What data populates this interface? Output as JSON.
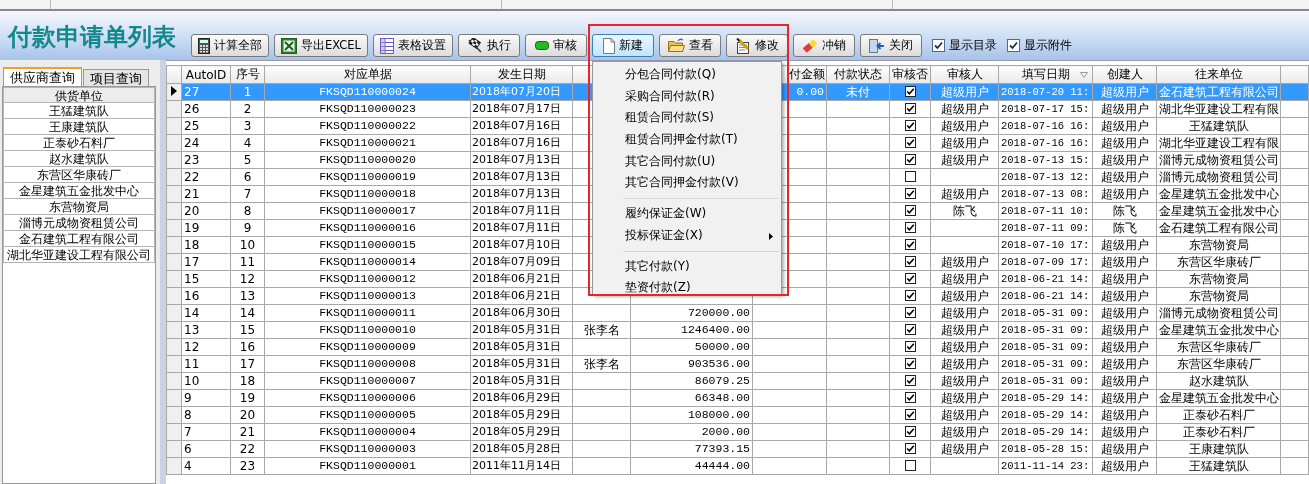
{
  "window": {
    "title": "付款申请单列表"
  },
  "toolbar": {
    "buttons": [
      {
        "label": "计算全部",
        "pressed": false
      },
      {
        "label": "导出EXCEL",
        "pressed": false
      },
      {
        "label": "表格设置",
        "pressed": false
      },
      {
        "label": "执行",
        "pressed": false
      },
      {
        "label": "审核",
        "pressed": false
      },
      {
        "label": "新建",
        "pressed": true
      },
      {
        "label": "查看",
        "pressed": false
      },
      {
        "label": "修改",
        "pressed": false
      },
      {
        "label": "冲销",
        "pressed": false
      },
      {
        "label": "关闭",
        "pressed": false
      }
    ],
    "checkboxes": [
      {
        "label": "显示目录",
        "checked": true
      },
      {
        "label": "显示附件",
        "checked": true
      }
    ]
  },
  "left_panel": {
    "tabs": [
      {
        "label": "供应商查询",
        "selected": true
      },
      {
        "label": "项目查询",
        "selected": false
      }
    ],
    "list_header": "供货单位",
    "items": [
      "王猛建筑队",
      "王康建筑队",
      "正泰砂石料厂",
      "赵水建筑队",
      "东营区华康砖厂",
      "金星建筑五金批发中心",
      "东营物资局",
      "淄博元成物资租赁公司",
      "金石建筑工程有限公司",
      "湖北华亚建设工程有限公司"
    ]
  },
  "table": {
    "columns": [
      {
        "label": "AutoID",
        "sorted": false
      },
      {
        "label": "序号",
        "sorted": false
      },
      {
        "label": "对应单据",
        "sorted": false
      },
      {
        "label": "发生日期",
        "sorted": false
      },
      {
        "label": "付金额",
        "sorted": false
      },
      {
        "label": "付款状态",
        "sorted": false
      },
      {
        "label": "审核否",
        "sorted": false
      },
      {
        "label": "审核人",
        "sorted": false
      },
      {
        "label": "填写日期",
        "sorted": true
      },
      {
        "label": "创建人",
        "sorted": false
      },
      {
        "label": "往来单位",
        "sorted": false
      }
    ],
    "rows": [
      {
        "selected": true,
        "auto_id": "27",
        "seq": "1",
        "doc_no": "FKSQD110000024",
        "date": "2018年07月20日",
        "column_7": "0.00",
        "status": "未付",
        "approved": true,
        "reviewer": "超级用户",
        "filled_date": "2018-07-20 11:",
        "creator": "超级用户",
        "partner": "金石建筑工程有限公司"
      },
      {
        "selected": false,
        "auto_id": "26",
        "seq": "2",
        "doc_no": "FKSQD110000023",
        "date": "2018年07月17日",
        "approved": true,
        "reviewer": "超级用户",
        "filled_date": "2018-07-17 15:",
        "creator": "超级用户",
        "partner": "湖北华亚建设工程有限"
      },
      {
        "selected": false,
        "auto_id": "25",
        "seq": "3",
        "doc_no": "FKSQD110000022",
        "date": "2018年07月16日",
        "approved": true,
        "reviewer": "超级用户",
        "filled_date": "2018-07-16 16:",
        "creator": "超级用户",
        "partner": "王猛建筑队"
      },
      {
        "selected": false,
        "auto_id": "24",
        "seq": "4",
        "doc_no": "FKSQD110000021",
        "date": "2018年07月16日",
        "approved": true,
        "reviewer": "超级用户",
        "filled_date": "2018-07-16 16:",
        "creator": "超级用户",
        "partner": "湖北华亚建设工程有限"
      },
      {
        "selected": false,
        "auto_id": "23",
        "seq": "5",
        "doc_no": "FKSQD110000020",
        "date": "2018年07月13日",
        "approved": true,
        "reviewer": "超级用户",
        "filled_date": "2018-07-13 15:",
        "creator": "超级用户",
        "partner": "淄博元成物资租赁公司"
      },
      {
        "selected": false,
        "auto_id": "22",
        "seq": "6",
        "doc_no": "FKSQD110000019",
        "date": "2018年07月13日",
        "approved": false,
        "filled_date": "2018-07-13 12:",
        "creator": "超级用户",
        "partner": "淄博元成物资租赁公司"
      },
      {
        "selected": false,
        "auto_id": "21",
        "seq": "7",
        "doc_no": "FKSQD110000018",
        "date": "2018年07月13日",
        "approved": true,
        "reviewer": "超级用户",
        "filled_date": "2018-07-13 08:",
        "creator": "超级用户",
        "partner": "金星建筑五金批发中心"
      },
      {
        "selected": false,
        "auto_id": "20",
        "seq": "8",
        "doc_no": "FKSQD110000017",
        "date": "2018年07月11日",
        "approved": true,
        "reviewer": "陈飞",
        "filled_date": "2018-07-11 10:",
        "creator": "陈飞",
        "partner": "金星建筑五金批发中心"
      },
      {
        "selected": false,
        "auto_id": "19",
        "seq": "9",
        "doc_no": "FKSQD110000016",
        "date": "2018年07月11日",
        "approved": true,
        "filled_date": "2018-07-11 09:",
        "creator": "陈飞",
        "partner": "金石建筑工程有限公司"
      },
      {
        "selected": false,
        "auto_id": "18",
        "seq": "10",
        "doc_no": "FKSQD110000015",
        "date": "2018年07月10日",
        "approved": true,
        "filled_date": "2018-07-10 17:",
        "creator": "超级用户",
        "partner": "东营物资局"
      },
      {
        "selected": false,
        "auto_id": "17",
        "seq": "11",
        "doc_no": "FKSQD110000014",
        "date": "2018年07月09日",
        "approved": true,
        "reviewer": "超级用户",
        "filled_date": "2018-07-09 17:",
        "creator": "超级用户",
        "partner": "东营区华康砖厂"
      },
      {
        "selected": false,
        "auto_id": "15",
        "seq": "12",
        "doc_no": "FKSQD110000012",
        "date": "2018年06月21日",
        "approved": true,
        "reviewer": "超级用户",
        "filled_date": "2018-06-21 14:",
        "creator": "超级用户",
        "partner": "东营物资局"
      },
      {
        "selected": false,
        "auto_id": "16",
        "seq": "13",
        "doc_no": "FKSQD110000013",
        "date": "2018年06月21日",
        "approved": true,
        "reviewer": "超级用户",
        "filled_date": "2018-06-21 14:",
        "creator": "超级用户",
        "partner": "东营物资局"
      },
      {
        "selected": false,
        "auto_id": "14",
        "seq": "14",
        "doc_no": "FKSQD110000011",
        "date": "2018年06月30日",
        "column_6": "720000.00",
        "approved": true,
        "reviewer": "超级用户",
        "filled_date": "2018-05-31 09:",
        "creator": "超级用户",
        "partner": "淄博元成物资租赁公司"
      },
      {
        "selected": false,
        "auto_id": "13",
        "seq": "15",
        "doc_no": "FKSQD110000010",
        "date": "2018年05月31日",
        "column_5": "张李名",
        "column_6": "1246400.00",
        "approved": true,
        "reviewer": "超级用户",
        "filled_date": "2018-05-31 09:",
        "creator": "超级用户",
        "partner": "金星建筑五金批发中心"
      },
      {
        "selected": false,
        "auto_id": "12",
        "seq": "16",
        "doc_no": "FKSQD110000009",
        "date": "2018年05月31日",
        "column_6": "50000.00",
        "approved": true,
        "reviewer": "超级用户",
        "filled_date": "2018-05-31 09:",
        "creator": "超级用户",
        "partner": "东营区华康砖厂"
      },
      {
        "selected": false,
        "auto_id": "11",
        "seq": "17",
        "doc_no": "FKSQD110000008",
        "date": "2018年05月31日",
        "column_5": "张李名",
        "column_6": "903536.00",
        "approved": true,
        "reviewer": "超级用户",
        "filled_date": "2018-05-31 09:",
        "creator": "超级用户",
        "partner": "东营区华康砖厂"
      },
      {
        "selected": false,
        "auto_id": "10",
        "seq": "18",
        "doc_no": "FKSQD110000007",
        "date": "2018年05月31日",
        "column_6": "86079.25",
        "approved": true,
        "reviewer": "超级用户",
        "filled_date": "2018-05-31 09:",
        "creator": "超级用户",
        "partner": "赵水建筑队"
      },
      {
        "selected": false,
        "auto_id": "9",
        "seq": "19",
        "doc_no": "FKSQD110000006",
        "date": "2018年06月29日",
        "column_6": "66348.00",
        "approved": true,
        "reviewer": "超级用户",
        "filled_date": "2018-05-29 14:",
        "creator": "超级用户",
        "partner": "金星建筑五金批发中心"
      },
      {
        "selected": false,
        "auto_id": "8",
        "seq": "20",
        "doc_no": "FKSQD110000005",
        "date": "2018年05月29日",
        "column_6": "108000.00",
        "approved": true,
        "reviewer": "超级用户",
        "filled_date": "2018-05-29 14:",
        "creator": "超级用户",
        "partner": "正泰砂石料厂"
      },
      {
        "selected": false,
        "auto_id": "7",
        "seq": "21",
        "doc_no": "FKSQD110000004",
        "date": "2018年05月29日",
        "column_6": "2000.00",
        "approved": true,
        "reviewer": "超级用户",
        "filled_date": "2018-05-29 14:",
        "creator": "超级用户",
        "partner": "正泰砂石料厂"
      },
      {
        "selected": false,
        "auto_id": "6",
        "seq": "22",
        "doc_no": "FKSQD110000003",
        "date": "2018年05月28日",
        "column_6": "77393.15",
        "approved": true,
        "reviewer": "超级用户",
        "filled_date": "2018-05-28 15:",
        "creator": "超级用户",
        "partner": "王康建筑队"
      },
      {
        "selected": false,
        "auto_id": "4",
        "seq": "23",
        "doc_no": "FKSQD110000001",
        "date": "2011年11月14日",
        "column_6": "44444.00",
        "approved": false,
        "filled_date": "2011-11-14 23:",
        "creator": "超级用户",
        "partner": "王猛建筑队"
      }
    ]
  },
  "context_menu": {
    "items": [
      {
        "kind": "item",
        "label": "分包合同付款(Q)",
        "submenu": false
      },
      {
        "kind": "item",
        "label": "采购合同付款(R)",
        "submenu": false
      },
      {
        "kind": "item",
        "label": "租赁合同付款(S)",
        "submenu": false
      },
      {
        "kind": "item",
        "label": "租赁合同押金付款(T)",
        "submenu": false
      },
      {
        "kind": "item",
        "label": "其它合同付款(U)",
        "submenu": false
      },
      {
        "kind": "item",
        "label": "其它合同押金付款(V)",
        "submenu": false
      },
      {
        "kind": "separator"
      },
      {
        "kind": "item",
        "label": "履约保证金(W)",
        "submenu": false
      },
      {
        "kind": "item",
        "label": "投标保证金(X)",
        "submenu": true
      },
      {
        "kind": "separator"
      },
      {
        "kind": "item",
        "label": "其它付款(Y)",
        "submenu": false
      },
      {
        "kind": "item",
        "label": "垫资付款(Z)",
        "submenu": false
      }
    ]
  }
}
